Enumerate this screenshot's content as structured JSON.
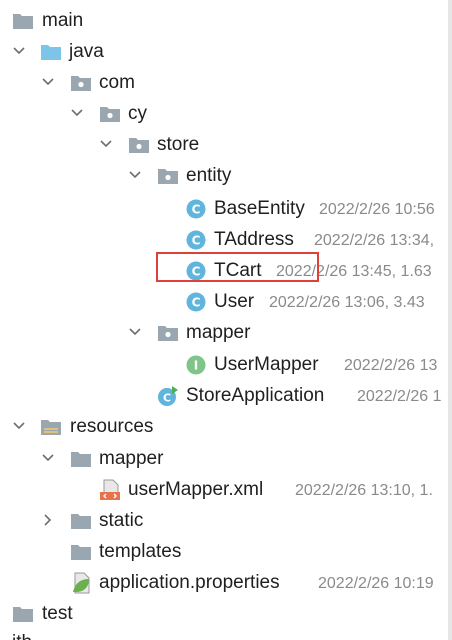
{
  "tree": {
    "items": [
      {
        "label": "main",
        "meta": ""
      },
      {
        "label": "java",
        "meta": ""
      },
      {
        "label": "com",
        "meta": ""
      },
      {
        "label": "cy",
        "meta": ""
      },
      {
        "label": "store",
        "meta": ""
      },
      {
        "label": "entity",
        "meta": ""
      },
      {
        "label": "BaseEntity",
        "meta": "2022/2/26 10:56"
      },
      {
        "label": "TAddress",
        "meta": "2022/2/26 13:34,"
      },
      {
        "label": "TCart",
        "meta": "2022/2/26 13:45, 1.63"
      },
      {
        "label": "User",
        "meta": "2022/2/26 13:06, 3.43"
      },
      {
        "label": "mapper",
        "meta": ""
      },
      {
        "label": "UserMapper",
        "meta": "2022/2/26 13"
      },
      {
        "label": "StoreApplication",
        "meta": "2022/2/26 1"
      },
      {
        "label": "resources",
        "meta": ""
      },
      {
        "label": "mapper",
        "meta": ""
      },
      {
        "label": "userMapper.xml",
        "meta": "2022/2/26 13:10, 1."
      },
      {
        "label": "static",
        "meta": ""
      },
      {
        "label": "templates",
        "meta": ""
      },
      {
        "label": "application.properties",
        "meta": "2022/2/26 10:19"
      },
      {
        "label": "test",
        "meta": ""
      },
      {
        "label": "ith",
        "meta": ""
      }
    ]
  },
  "icons": {
    "class": "class-icon",
    "interface": "interface-icon",
    "folder": "folder-icon",
    "package": "package-icon"
  },
  "colors": {
    "folder_gray": "#9aa7b0",
    "folder_blue": "#7cc4e8",
    "class_circle": "#5fb5dc",
    "interface_circle": "#7fc58a",
    "highlight": "#e0403a"
  }
}
